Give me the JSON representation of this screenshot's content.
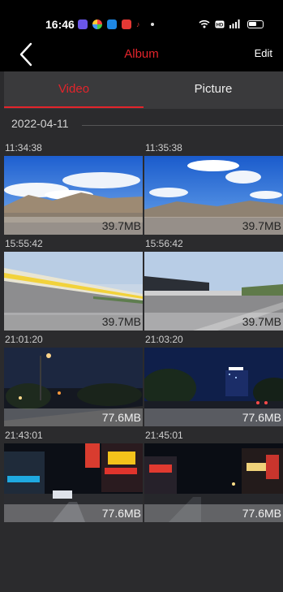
{
  "status": {
    "time": "16:46"
  },
  "header": {
    "title": "Album",
    "edit_label": "Edit"
  },
  "tabs": [
    {
      "label": "Video",
      "active": true
    },
    {
      "label": "Picture",
      "active": false
    }
  ],
  "date_group": "2022-04-11",
  "accent_color": "#e3242b",
  "videos": [
    {
      "time": "11:34:38",
      "size": "39.7MB",
      "scene": "day-mountains"
    },
    {
      "time": "11:35:38",
      "size": "39.7MB",
      "scene": "day-sky"
    },
    {
      "time": "15:55:42",
      "size": "39.7MB",
      "scene": "day-track"
    },
    {
      "time": "15:56:42",
      "size": "39.7MB",
      "scene": "day-track-stand"
    },
    {
      "time": "21:01:20",
      "size": "77.6MB",
      "scene": "night-street"
    },
    {
      "time": "21:03:20",
      "size": "77.6MB",
      "scene": "night-city"
    },
    {
      "time": "21:43:01",
      "size": "77.6MB",
      "scene": "night-shops"
    },
    {
      "time": "21:45:01",
      "size": "77.6MB",
      "scene": "night-shops-2"
    }
  ]
}
